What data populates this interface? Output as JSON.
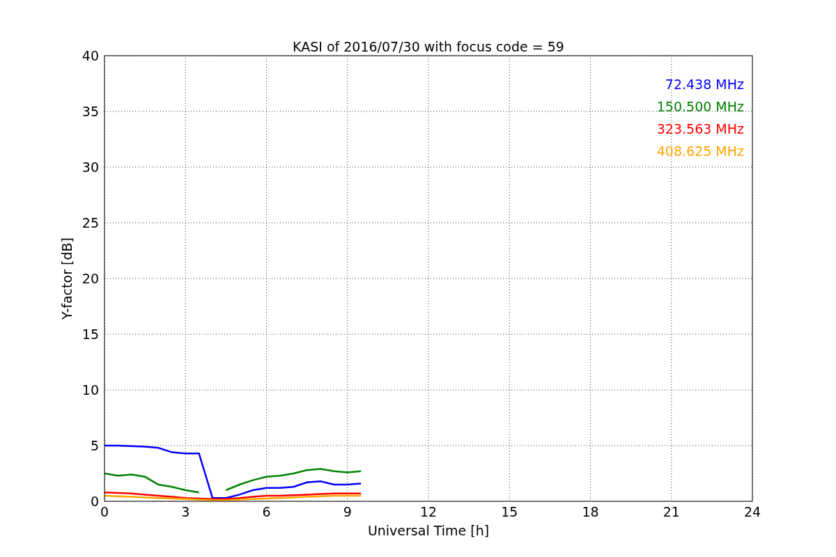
{
  "chart_data": {
    "type": "line",
    "title": "KASI of 2016/07/30 with focus code = 59",
    "xlabel": "Universal Time [h]",
    "ylabel": "Y-factor [dB]",
    "x": [
      0,
      0.5,
      1,
      1.5,
      2,
      2.5,
      3,
      3.5,
      4,
      4.5,
      5,
      5.5,
      6,
      6.5,
      7,
      7.5,
      8,
      8.5,
      9,
      9.5
    ],
    "series": [
      {
        "name": "72.438 MHz",
        "color": "#0000ff",
        "values": [
          5.0,
          5.0,
          4.95,
          4.9,
          4.8,
          4.4,
          4.3,
          4.3,
          0.3,
          0.3,
          0.6,
          1.0,
          1.2,
          1.2,
          1.3,
          1.7,
          1.8,
          1.5,
          1.5,
          1.6
        ]
      },
      {
        "name": "150.500 MHz",
        "color": "#008000",
        "values": [
          2.5,
          2.3,
          2.4,
          2.2,
          1.5,
          1.3,
          1.0,
          0.8,
          null,
          1.0,
          1.5,
          1.9,
          2.2,
          2.3,
          2.5,
          2.8,
          2.9,
          2.7,
          2.6,
          2.7
        ]
      },
      {
        "name": "323.563 MHz",
        "color": "#ff0000",
        "values": [
          0.8,
          0.75,
          0.7,
          0.6,
          0.5,
          0.4,
          0.3,
          0.25,
          0.2,
          0.2,
          0.3,
          0.4,
          0.5,
          0.5,
          0.55,
          0.6,
          0.65,
          0.7,
          0.7,
          0.7
        ]
      },
      {
        "name": "408.625 MHz",
        "color": "#ffa500",
        "values": [
          0.5,
          0.45,
          0.4,
          0.35,
          0.3,
          0.25,
          0.2,
          0.15,
          0.1,
          0.1,
          0.15,
          0.2,
          0.25,
          0.3,
          0.35,
          0.4,
          0.45,
          0.5,
          0.5,
          0.5
        ]
      }
    ],
    "xlim": [
      0,
      24
    ],
    "ylim": [
      0,
      40
    ],
    "xticks": [
      0,
      3,
      6,
      9,
      12,
      15,
      18,
      21,
      24
    ],
    "yticks": [
      0,
      5,
      10,
      15,
      20,
      25,
      30,
      35,
      40
    ],
    "grid": true
  }
}
